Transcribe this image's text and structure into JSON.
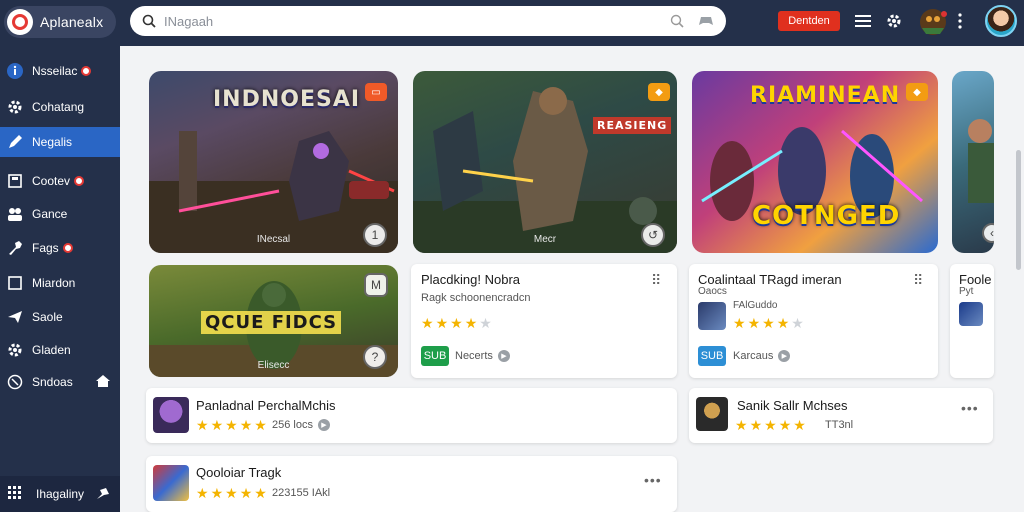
{
  "app": {
    "name": "Aplanealx",
    "brand_color": "#e53935",
    "nav_bg": "#24304a",
    "accent": "#2a66c5"
  },
  "search": {
    "placeholder": "INagaah",
    "icon": "search-icon"
  },
  "header": {
    "cta_label": "Dentden",
    "icons": [
      "search-icon",
      "gamepad-icon",
      "list-icon",
      "gear-icon",
      "game-avatar",
      "kebab-icon",
      "user-avatar"
    ]
  },
  "sidebar": {
    "items": [
      {
        "label": "Nsseilac",
        "icon": "info-icon",
        "badge": true,
        "active": false
      },
      {
        "label": "Cohatang",
        "icon": "gear-icon",
        "badge": false,
        "active": false
      },
      {
        "label": "Negalis",
        "icon": "pen-icon",
        "badge": false,
        "active": true
      },
      {
        "label": "Cootev",
        "icon": "save-icon",
        "badge": true,
        "active": false
      },
      {
        "label": "Gance",
        "icon": "group-icon",
        "badge": false,
        "active": false
      },
      {
        "label": "Fags",
        "icon": "tools-icon",
        "badge": true,
        "active": false
      },
      {
        "label": "Miardon",
        "icon": "square-icon",
        "badge": false,
        "active": false
      },
      {
        "label": "Saole",
        "icon": "send-icon",
        "badge": false,
        "active": false
      },
      {
        "label": "Gladen",
        "icon": "gear-icon",
        "badge": false,
        "active": false
      },
      {
        "label": "Sndoas",
        "icon": "globe-icon",
        "badge": false,
        "active": false,
        "trailing_icon": "home-icon"
      }
    ],
    "bottom": {
      "label": "Ihagaliny",
      "icon": "grid-icon",
      "trailing_icon": "pin-icon"
    }
  },
  "featured": [
    {
      "title": "INDNOESAI",
      "caption": "INecsal",
      "corner_badge": "▭",
      "action": "1"
    },
    {
      "title": "REASIENG",
      "caption": "Mecr",
      "corner_badge": "◆",
      "action": "↺"
    },
    {
      "title": "COTNGED",
      "subtitle": "RIAMINEAN",
      "caption": "",
      "corner_badge": "◆",
      "action": ""
    },
    {
      "title": "",
      "caption": "",
      "corner_badge": "",
      "action": "‹"
    }
  ],
  "promo": {
    "title": "QCUE FIDCS",
    "caption": "Elisecc",
    "top_action": "M",
    "bottom_action": "?"
  },
  "cards": [
    {
      "title": "Placdking! Nobra",
      "subtitle": "Ragk schoonencradcn",
      "rating": 4,
      "pill": "SUB",
      "pill_color": "#1e9e4a",
      "meta": "Necerts"
    },
    {
      "title": "Coalintaal TRagd imeran",
      "subtitle": "Oaocs",
      "subtitle2": "FAlGuddo",
      "rating": 4,
      "pill": "SUB",
      "pill_color": "#2d8fd5",
      "meta": "Karcaus"
    },
    {
      "title": "Foole",
      "subtitle": "Pyt",
      "rating": 0,
      "pill": "",
      "meta": ""
    }
  ],
  "list": [
    {
      "title": "Panladnal PerchalMchis",
      "rating": 5,
      "meta": "256 locs"
    },
    {
      "title": "Sanik Sallr Mchses",
      "rating": 5,
      "meta": "TT3nl"
    },
    {
      "title": "Qooloiar Tragk",
      "rating": 5,
      "meta": "223155 IAkl"
    }
  ]
}
